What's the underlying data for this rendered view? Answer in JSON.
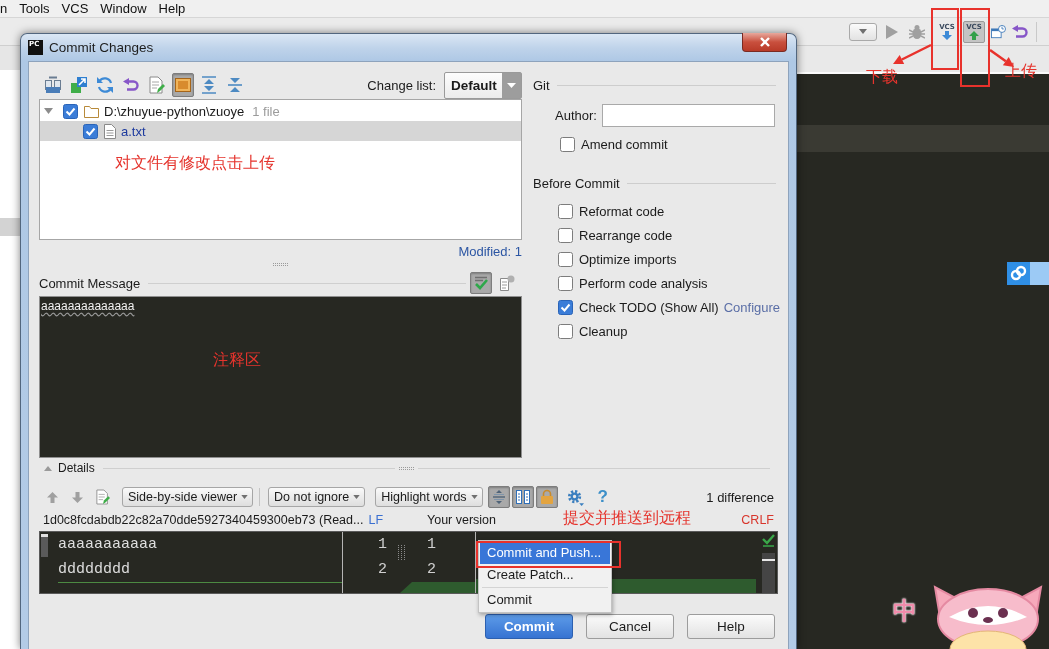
{
  "menu_bar": {
    "items": [
      "n",
      "Tools",
      "VCS",
      "Window",
      "Help"
    ]
  },
  "toolbar": {
    "buttons": [
      {
        "kind": "dropdown",
        "pressed": false
      },
      {
        "kind": "run",
        "pressed": false
      },
      {
        "kind": "debug",
        "pressed": false
      },
      {
        "kind": "vcs-update",
        "label": "VCS",
        "pressed": false
      },
      {
        "kind": "vcs-commit",
        "label": "VCS",
        "pressed": true
      },
      {
        "kind": "history",
        "pressed": false
      },
      {
        "kind": "revert",
        "pressed": false
      }
    ]
  },
  "dialog": {
    "app_icon": "PC",
    "title": "Commit Changes",
    "changes_toolbar": [
      {
        "kind": "show-diff",
        "pressed": false
      },
      {
        "kind": "move",
        "pressed": false
      },
      {
        "kind": "refresh",
        "pressed": false
      },
      {
        "kind": "rollback",
        "pressed": false
      },
      {
        "kind": "edit",
        "pressed": false
      },
      {
        "kind": "preview",
        "pressed": true
      },
      {
        "kind": "expand-all",
        "pressed": false
      },
      {
        "kind": "collapse-all",
        "pressed": false
      }
    ],
    "change_list": {
      "label": "Change list:",
      "value": "Default"
    },
    "changes": [
      {
        "label": "D:\\zhuyue-python\\zuoye",
        "count": "1 file",
        "checked": true,
        "expanded": true,
        "selected": false,
        "children": [
          {
            "label": "a.txt",
            "checked": true,
            "selected": true
          }
        ]
      }
    ],
    "summary": "Modified: 1",
    "commit_message": {
      "label": "Commit Message",
      "value": "aaaaaaaaaaaaaa",
      "tools": [
        {
          "kind": "spellcheck",
          "pressed": true
        },
        {
          "kind": "history",
          "pressed": false
        }
      ]
    },
    "git": {
      "title": "Git",
      "author_label": "Author:",
      "amend": {
        "label": "Amend commit",
        "checked": false
      }
    },
    "before_commit": {
      "title": "Before Commit",
      "options": [
        {
          "label": "Reformat code",
          "checked": false
        },
        {
          "label": "Rearrange code",
          "checked": false
        },
        {
          "label": "Optimize imports",
          "checked": false
        },
        {
          "label": "Perform code analysis",
          "checked": false
        },
        {
          "label": "Check TODO (Show All)",
          "checked": true,
          "link": "Configure"
        },
        {
          "label": "Cleanup",
          "checked": false
        }
      ]
    },
    "details": {
      "title": "Details",
      "expanded": true,
      "viewer": "Side-by-side viewer",
      "ignore": "Do not ignore",
      "highlight": "Highlight words",
      "tools": [
        {
          "kind": "align",
          "pressed": true
        },
        {
          "kind": "columns",
          "pressed": true
        },
        {
          "kind": "lock",
          "pressed": true
        }
      ],
      "help": "?",
      "differences": "1 difference",
      "left_title": "1d0c8fcdabdb22c82a70dde5927340459300eb73 (Read...",
      "left_separator": "LF",
      "right_title": "Your version",
      "right_separator": "CRLF",
      "lines": [
        {
          "text": "aaaaaaaaaaa",
          "left_number": "1",
          "right_number": "1"
        },
        {
          "text": "dddddddd",
          "left_number": "2",
          "right_number": "2"
        }
      ]
    },
    "commit_menu": [
      {
        "label": "Commit and Push...",
        "selected": true
      },
      {
        "label": "Create Patch...",
        "selected": false
      },
      {
        "label": "Commit",
        "selected": false
      }
    ],
    "buttons": [
      {
        "label": "Commit",
        "kind": "default"
      },
      {
        "label": "Cancel",
        "kind": "normal"
      },
      {
        "label": "Help",
        "kind": "normal"
      }
    ]
  },
  "annotations": [
    {
      "kind": "frame"
    },
    {
      "kind": "frame"
    },
    {
      "kind": "arrow"
    },
    {
      "kind": "arrow"
    },
    {
      "kind": "label",
      "text": "下载"
    },
    {
      "kind": "label",
      "text": "上传"
    },
    {
      "kind": "label",
      "text": "对文件有修改点击上传"
    },
    {
      "kind": "label",
      "text": "注释区"
    },
    {
      "kind": "label",
      "text": "提交并推送到远程"
    },
    {
      "kind": "frame"
    }
  ],
  "ime": {
    "mode": "中"
  }
}
